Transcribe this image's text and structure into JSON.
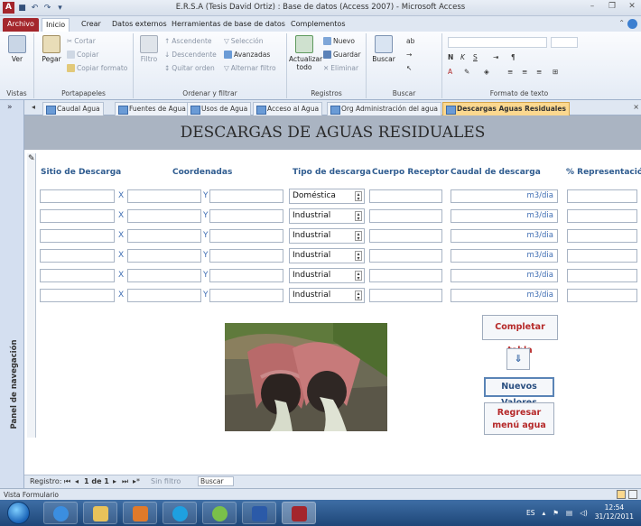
{
  "window": {
    "title": "E.R.S.A (Tesis David Ortiz) : Base de datos (Access 2007) - Microsoft Access",
    "logo": "A"
  },
  "ribbon_tabs": [
    "Archivo",
    "Inicio",
    "Crear",
    "Datos externos",
    "Herramientas de base de datos",
    "Complementos"
  ],
  "ribbon": {
    "vistas": {
      "view_label": "Ver",
      "group": "Vistas"
    },
    "portapapeles": {
      "paste": "Pegar",
      "cut": "Cortar",
      "copy": "Copiar",
      "format_painter": "Copiar formato",
      "group": "Portapapeles"
    },
    "ordenar": {
      "filter": "Filtro",
      "asc": "Ascendente",
      "desc": "Descendente",
      "remove_sort": "Quitar orden",
      "selection": "Selección",
      "advanced": "Avanzadas",
      "toggle_filter": "Alternar filtro",
      "group": "Ordenar y filtrar"
    },
    "registros": {
      "refresh": "Actualizar todo",
      "new": "Nuevo",
      "save": "Guardar",
      "delete": "Eliminar",
      "group": "Registros"
    },
    "buscar": {
      "find": "Buscar",
      "group": "Buscar"
    },
    "formato": {
      "bold": "N",
      "italic": "K",
      "underline": "S",
      "font_color": "A",
      "group": "Formato de texto"
    }
  },
  "nav_pane": {
    "label": "Panel de navegación"
  },
  "doc_tabs": [
    "Caudal Agua",
    "Fuentes de Agua",
    "Usos de Agua",
    "Acceso al Agua",
    "Org Administración del agua",
    "Descargas Aguas Residuales"
  ],
  "form": {
    "title": "DESCARGAS DE AGUAS RESIDUALES",
    "columns": {
      "sitio": "Sitio de Descarga",
      "coordenadas": "Coordenadas",
      "tipo": "Tipo de descarga",
      "cuerpo": "Cuerpo Receptor",
      "caudal": "Caudal de descarga",
      "representacion": "% Representación"
    },
    "sep_x": "X",
    "sep_y": "Y",
    "unit": "m3/dia",
    "rows": [
      {
        "tipo": "Doméstica"
      },
      {
        "tipo": "Industrial"
      },
      {
        "tipo": "Industrial"
      },
      {
        "tipo": "Industrial"
      },
      {
        "tipo": "Industrial"
      },
      {
        "tipo": "Industrial"
      }
    ],
    "buttons": {
      "completar": "Completar tabla",
      "nuevos": "Nuevos Valores",
      "regresar": "Regresar menú agua"
    }
  },
  "record_nav": {
    "label": "Registro:",
    "position": "1 de 1",
    "filter": "Sin filtro",
    "search": "Buscar"
  },
  "status": {
    "text": "Vista Formulario"
  },
  "tray": {
    "lang": "ES",
    "time": "12:54",
    "date": "31/12/2011"
  }
}
